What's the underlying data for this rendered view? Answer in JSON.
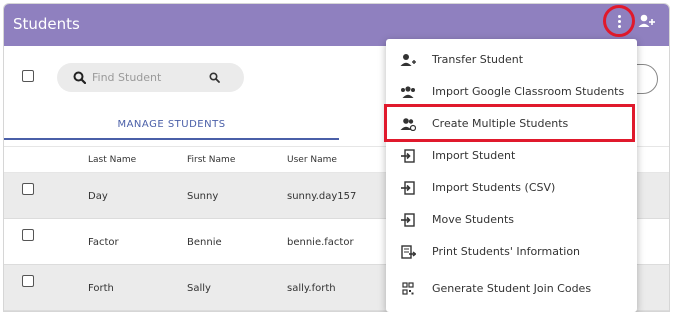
{
  "header": {
    "title": "Students"
  },
  "search": {
    "placeholder": "Find Student"
  },
  "tabs": [
    {
      "label": "MANAGE STUDENTS"
    }
  ],
  "table": {
    "columns": [
      "Last Name",
      "First Name",
      "User Name"
    ],
    "rows": [
      {
        "last": "Day",
        "first": "Sunny",
        "user": "sunny.day157"
      },
      {
        "last": "Factor",
        "first": "Bennie",
        "user": "bennie.factor"
      },
      {
        "last": "Forth",
        "first": "Sally",
        "user": "sally.forth"
      }
    ]
  },
  "menu": {
    "items": [
      {
        "label": "Transfer Student",
        "icon": "transfer-student-icon"
      },
      {
        "label": "Import Google Classroom Students",
        "icon": "google-classroom-icon"
      },
      {
        "label": "Create Multiple Students",
        "icon": "multiple-students-icon"
      },
      {
        "label": "Import Student",
        "icon": "import-icon"
      },
      {
        "label": "Import Students (CSV)",
        "icon": "import-csv-icon"
      },
      {
        "label": "Move Students",
        "icon": "move-icon"
      },
      {
        "label": "Print Students' Information",
        "icon": "print-icon"
      },
      {
        "label": "Generate Student Join Codes",
        "icon": "qr-code-icon"
      }
    ],
    "highlighted": "Create Multiple Students"
  },
  "colors": {
    "header": "#8f80bf",
    "accent": "#4a5fa8",
    "highlight": "#e0192c",
    "shaded_row": "#ebebeb"
  }
}
